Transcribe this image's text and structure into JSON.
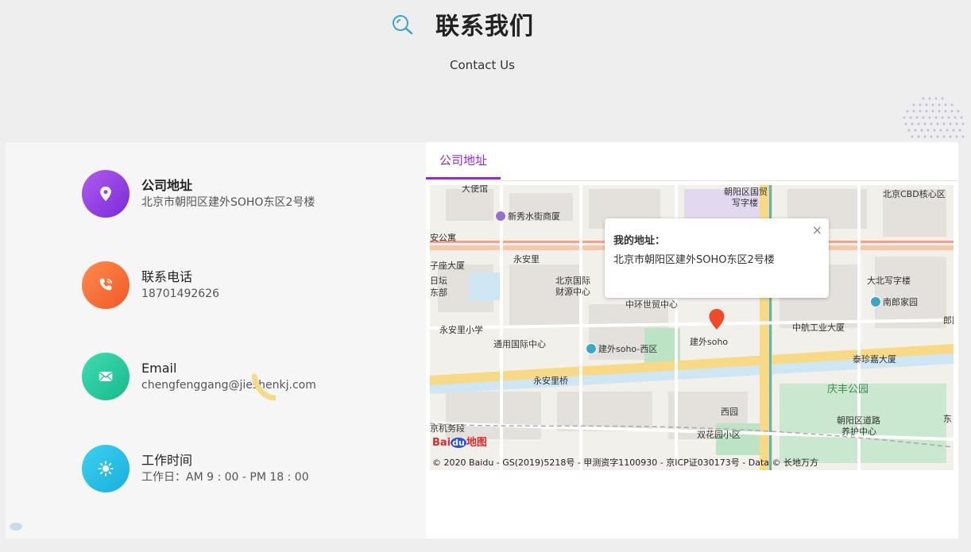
{
  "header": {
    "title": "联系我们",
    "subtitle": "Contact Us"
  },
  "contact": {
    "items": [
      {
        "label": "公司地址",
        "value": "北京市朝阳区建外SOHO东区2号楼",
        "icon": "location-pin-icon"
      },
      {
        "label": "联系电话",
        "value": "18701492626",
        "icon": "phone-icon"
      },
      {
        "label": "Email",
        "value": "chengfenggang@jieshenkj.com",
        "icon": "mail-icon"
      },
      {
        "label": "工作时间",
        "value": "工作日：AM 9 : 00 - PM 18 : 00",
        "icon": "sun-icon"
      }
    ]
  },
  "map": {
    "tab_label": "公司地址",
    "popup": {
      "title": "我的地址：",
      "address": "北京市朝阳区建外SOHO东区2号楼",
      "close": "×"
    },
    "pois": [
      {
        "name": "朝阳区国贸"
      },
      {
        "name": "写字楼"
      },
      {
        "name": "北京CBD核心区"
      },
      {
        "name": "新秀水街商厦"
      },
      {
        "name": "永安里"
      },
      {
        "name": "北京国际"
      },
      {
        "name": "财源中心"
      },
      {
        "name": "中环世贸中心"
      },
      {
        "name": "大北写字楼"
      },
      {
        "name": "南郎家园"
      },
      {
        "name": "郎园"
      },
      {
        "name": "永安里小学"
      },
      {
        "name": "通用国际中心"
      },
      {
        "name": "建外soho-西区"
      },
      {
        "name": "建外soho"
      },
      {
        "name": "中航工业大厦"
      },
      {
        "name": "泰珍嘉大厦"
      },
      {
        "name": "永安里桥"
      },
      {
        "name": "庆丰公园"
      },
      {
        "name": "西园"
      },
      {
        "name": "朝阳区道路"
      },
      {
        "name": "养护中心"
      },
      {
        "name": "双花园小区"
      },
      {
        "name": "京机务段"
      },
      {
        "name": "子座大厦"
      },
      {
        "name": "大使馆"
      },
      {
        "name": "安公寓"
      },
      {
        "name": "日坛"
      },
      {
        "name": "东部"
      },
      {
        "name": "东"
      }
    ],
    "logo_text_1": "Bai",
    "logo_text_2": "du",
    "logo_text_3": "地图",
    "copyright": "© 2020 Baidu - GS(2019)5218号 - 甲测资字1100930 - 京ICP证030173号 - Data © 长地万方"
  }
}
